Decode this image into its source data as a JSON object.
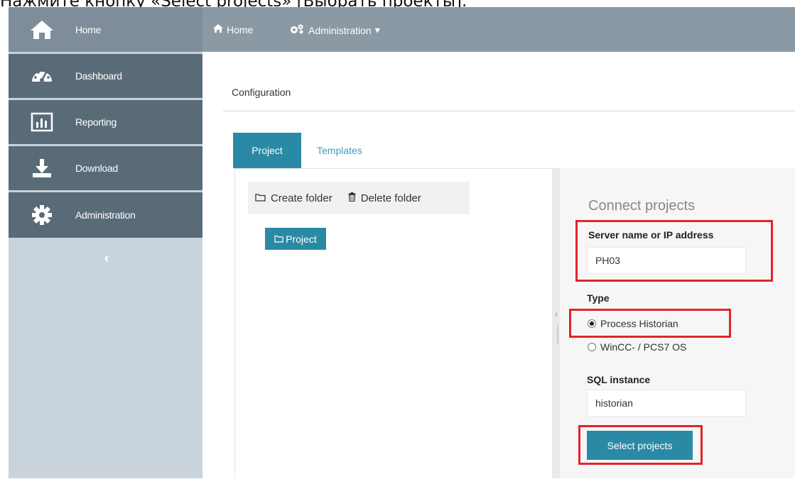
{
  "caption": "Нажмите кнопку «Select projects» [Выбрать проекты].",
  "sidebar": {
    "items": [
      {
        "label": "Home",
        "icon": "home-icon"
      },
      {
        "label": "Dashboard",
        "icon": "dashboard-icon"
      },
      {
        "label": "Reporting",
        "icon": "reporting-icon"
      },
      {
        "label": "Download",
        "icon": "download-icon"
      },
      {
        "label": "Administration",
        "icon": "gear-icon"
      }
    ],
    "collapse_glyph": "‹"
  },
  "topbar": {
    "home_label": "Home",
    "admin_label": "Administration",
    "admin_caret": "▾"
  },
  "main": {
    "title": "Configuration",
    "tabs": [
      {
        "label": "Project",
        "active": true
      },
      {
        "label": "Templates",
        "active": false
      }
    ],
    "folder_toolbar": {
      "create_label": "Create folder",
      "delete_label": "Delete folder"
    },
    "tree": {
      "node_label": "Project"
    }
  },
  "connect": {
    "title": "Connect projects",
    "server_label": "Server name or IP address",
    "server_value": "PH03",
    "type_label": "Type",
    "type_options": [
      {
        "label": "Process Historian",
        "selected": true
      },
      {
        "label": "WinCC- / PCS7 OS",
        "selected": false
      }
    ],
    "sql_label": "SQL instance",
    "sql_value": "historian",
    "select_button": "Select projects"
  },
  "colors": {
    "accent": "#2a8aa5",
    "sidebar_active": "#7e8d99",
    "sidebar_item": "#5a6b78",
    "sidebar_bg": "#c9d3dc",
    "topbar": "#8b99a4",
    "highlight": "#e2242b"
  }
}
